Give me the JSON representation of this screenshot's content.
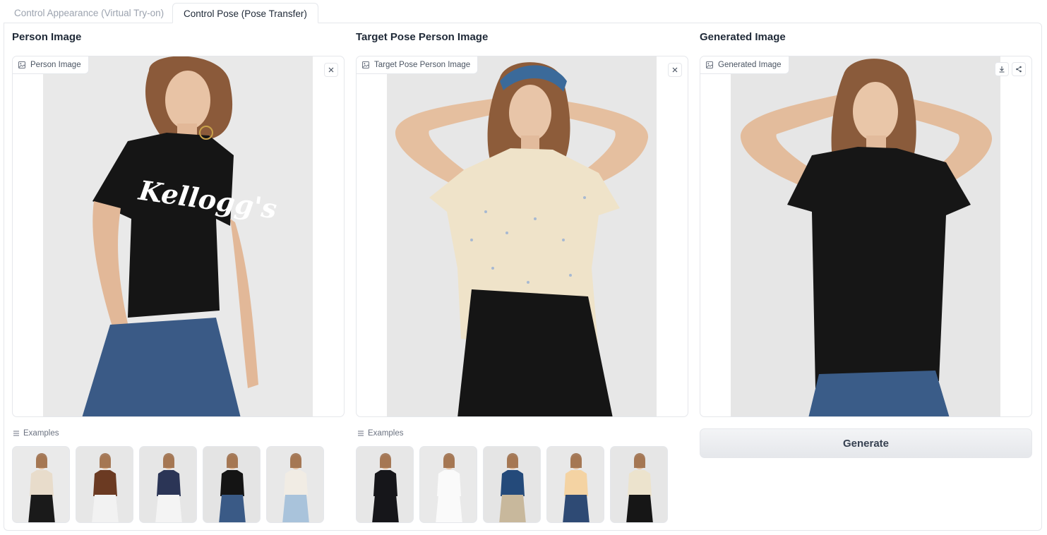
{
  "tabs": [
    {
      "label": "Control Appearance (Virtual Try-on)",
      "active": false
    },
    {
      "label": "Control Pose (Pose Transfer)",
      "active": true
    }
  ],
  "columns": {
    "person": {
      "title": "Person Image",
      "label": "Person Image",
      "examples_label": "Examples"
    },
    "target": {
      "title": "Target Pose Person Image",
      "label": "Target Pose Person Image",
      "examples_label": "Examples"
    },
    "generated": {
      "title": "Generated Image",
      "label": "Generated Image"
    }
  },
  "person_image": {
    "shirt_text": "Kellogg's",
    "shirt_color": "#141414",
    "pants_color": "#3a5a86"
  },
  "person_examples": [
    {
      "top": "#e8dccb",
      "bottom": "#1a1a1a",
      "bg": "#eaeaea"
    },
    {
      "top": "#6b3a22",
      "bottom": "#f2f2f2",
      "bg": "#e7e7e7"
    },
    {
      "top": "#2b3556",
      "bottom": "#f4f4f4",
      "bg": "#e6e6e6"
    },
    {
      "top": "#141414",
      "bottom": "#3a5a86",
      "bg": "#e4e4e4"
    },
    {
      "top": "#f1ece4",
      "bottom": "#a9c3db",
      "bg": "#e8e8e8"
    }
  ],
  "target_examples": [
    {
      "top": "#16161a",
      "bottom": "#16161a",
      "bg": "#e7e7e7"
    },
    {
      "top": "#fafafa",
      "bottom": "#fafafa",
      "bg": "#e9e9e9"
    },
    {
      "top": "#244a7a",
      "bottom": "#c8b89c",
      "bg": "#e5e5e5"
    },
    {
      "top": "#f4d3a3",
      "bottom": "#2e4a74",
      "bg": "#e8e8e8"
    },
    {
      "top": "#ece3cd",
      "bottom": "#161616",
      "bg": "#e6e6e6"
    }
  ],
  "generate_label": "Generate"
}
